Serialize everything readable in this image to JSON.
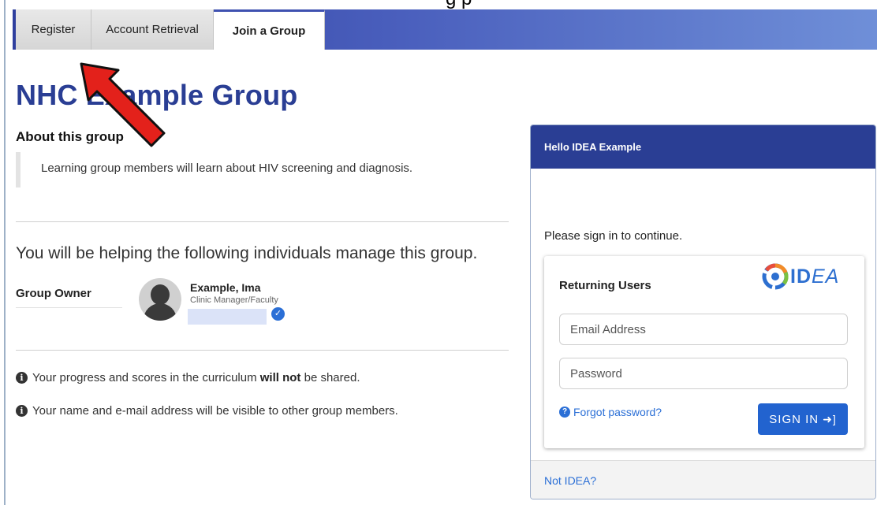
{
  "top_cutoff_text": "g              p",
  "tabs": [
    {
      "label": "Register"
    },
    {
      "label": "Account Retrieval"
    },
    {
      "label": "Join a Group"
    }
  ],
  "page_title": "NHC Example Group",
  "about": {
    "label": "About this group",
    "text": "Learning group members will learn about HIV screening and diagnosis."
  },
  "helping_text": "You will be helping the following individuals manage this group.",
  "owner": {
    "label": "Group Owner",
    "name": "Example, Ima",
    "role": "Clinic Manager/Faculty"
  },
  "notes": {
    "progress_pre": "Your progress and scores in the curriculum ",
    "progress_bold": "will not",
    "progress_post": " be shared.",
    "visibility": "Your name and e-mail address will be visible to other group members."
  },
  "card": {
    "header": "Hello IDEA Example",
    "please": "Please sign in to continue.",
    "returning": "Returning Users",
    "logo_bold": "ID",
    "logo_italic": "EA",
    "email_placeholder": "Email Address",
    "password_placeholder": "Password",
    "forgot": "Forgot password?",
    "signin": "SIGN IN",
    "not_idea": "Not IDEA?"
  },
  "colors": {
    "brand_navy": "#2a3e94",
    "link_blue": "#2b6fd6",
    "button_blue": "#2263cf",
    "annotation_red": "#e3211b"
  },
  "icons": [
    "info-icon",
    "question-icon",
    "sign-in-icon",
    "verified-check-icon",
    "avatar-placeholder",
    "idea-logo-icon",
    "red-annotation-arrow"
  ]
}
